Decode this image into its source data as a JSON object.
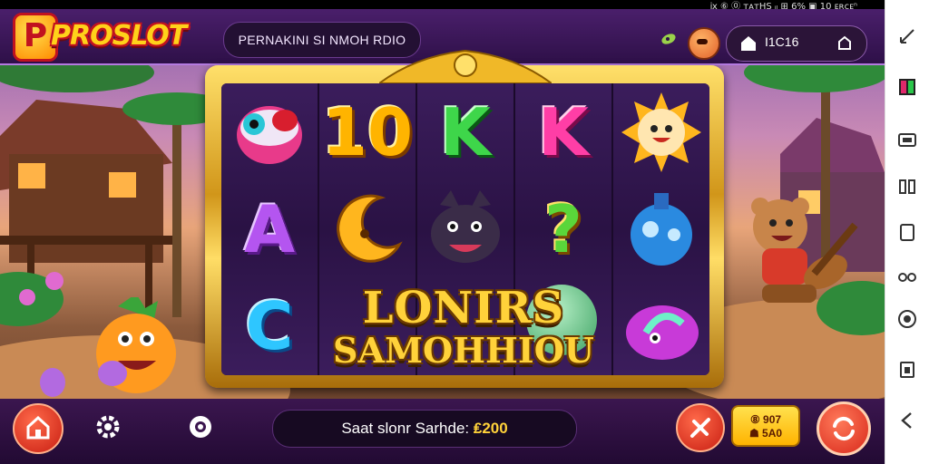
{
  "status_bar": {
    "text": "ⅸ ⑥ ⓪ ᴛᴀᴛHS ᵢₗ ⊞ 6% ▣ 10 ᴇʀᴄᴇⁿ"
  },
  "header": {
    "logo_text": "PROSLOT",
    "logo_letter": "P",
    "marquee_text": "PERNAKINI SI NMOH RDIO",
    "right_label": "I1C16"
  },
  "reels": {
    "columns": [
      [
        "red-ball-icon",
        "letter-A",
        "letter-C"
      ],
      [
        "number-10",
        "moon-icon",
        ""
      ],
      [
        "letter-K",
        "wolf-icon",
        ""
      ],
      [
        "letter-K",
        "question-icon",
        ""
      ],
      [
        "sun-icon",
        "potion-icon",
        "snail-icon"
      ]
    ],
    "letters": {
      "A": "A",
      "C": "C",
      "K": "K",
      "ten": "10",
      "q": "?"
    }
  },
  "win_banner": {
    "line1": "LONIRS",
    "line2": "SAMOHHIOU"
  },
  "bottom": {
    "bet_label": "Saat slonr Sarhde:",
    "bet_value": "₤200",
    "total_line1": "⑧ 907",
    "total_line2": "☗ 5A0"
  },
  "colors": {
    "accent": "#ffd23a",
    "header": "#4a1f6b",
    "spin": "#e23a2e"
  }
}
